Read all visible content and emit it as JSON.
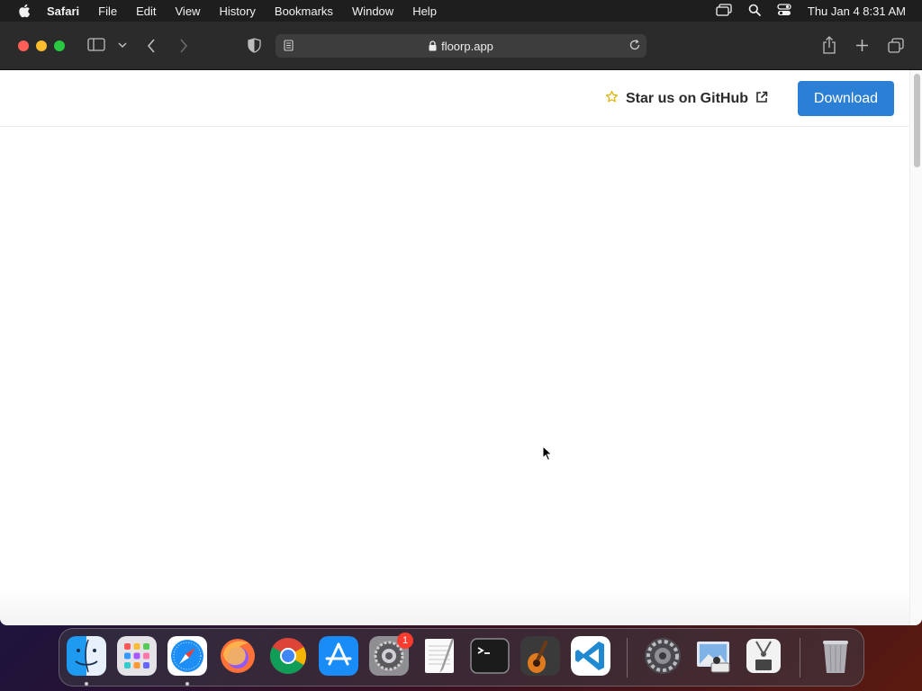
{
  "menubar": {
    "app_name": "Safari",
    "items": [
      "File",
      "Edit",
      "View",
      "History",
      "Bookmarks",
      "Window",
      "Help"
    ],
    "clock": "Thu Jan 4  8:31 AM"
  },
  "browser": {
    "url": "floorp.app"
  },
  "site": {
    "github_label": "Star us on GitHub",
    "download_label": "Download",
    "accent_color": "#2b7fd4"
  },
  "dock": {
    "apps": [
      "finder",
      "launchpad",
      "safari",
      "firefox",
      "chrome",
      "app-store",
      "system-settings",
      "textedit",
      "terminal",
      "garageband",
      "vscode",
      "system-preferences",
      "preview",
      "system-information",
      "trash"
    ],
    "settings_badge": "1"
  }
}
